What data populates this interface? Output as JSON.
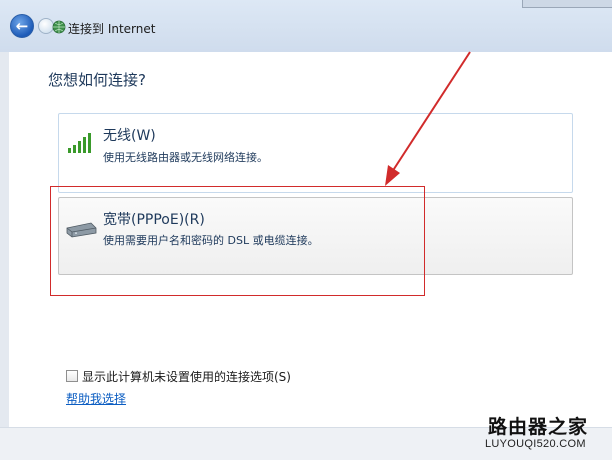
{
  "window": {
    "title": "连接到 Internet"
  },
  "main": {
    "question": "您想如何连接?",
    "options": [
      {
        "title": "无线(W)",
        "description": "使用无线路由器或无线网络连接。",
        "icon": "signal-bars-icon"
      },
      {
        "title": "宽带(PPPoE)(R)",
        "description": "使用需要用户名和密码的 DSL 或电缆连接。",
        "icon": "modem-icon"
      }
    ],
    "show_unconfigured": {
      "label": "显示此计算机未设置使用的连接选项(S)",
      "checked": false
    },
    "help_link": "帮助我选择"
  },
  "annotation": {
    "color": "#d12b2b"
  },
  "watermark": {
    "title": "路由器之家",
    "url": "LUYOUQI520.COM"
  }
}
